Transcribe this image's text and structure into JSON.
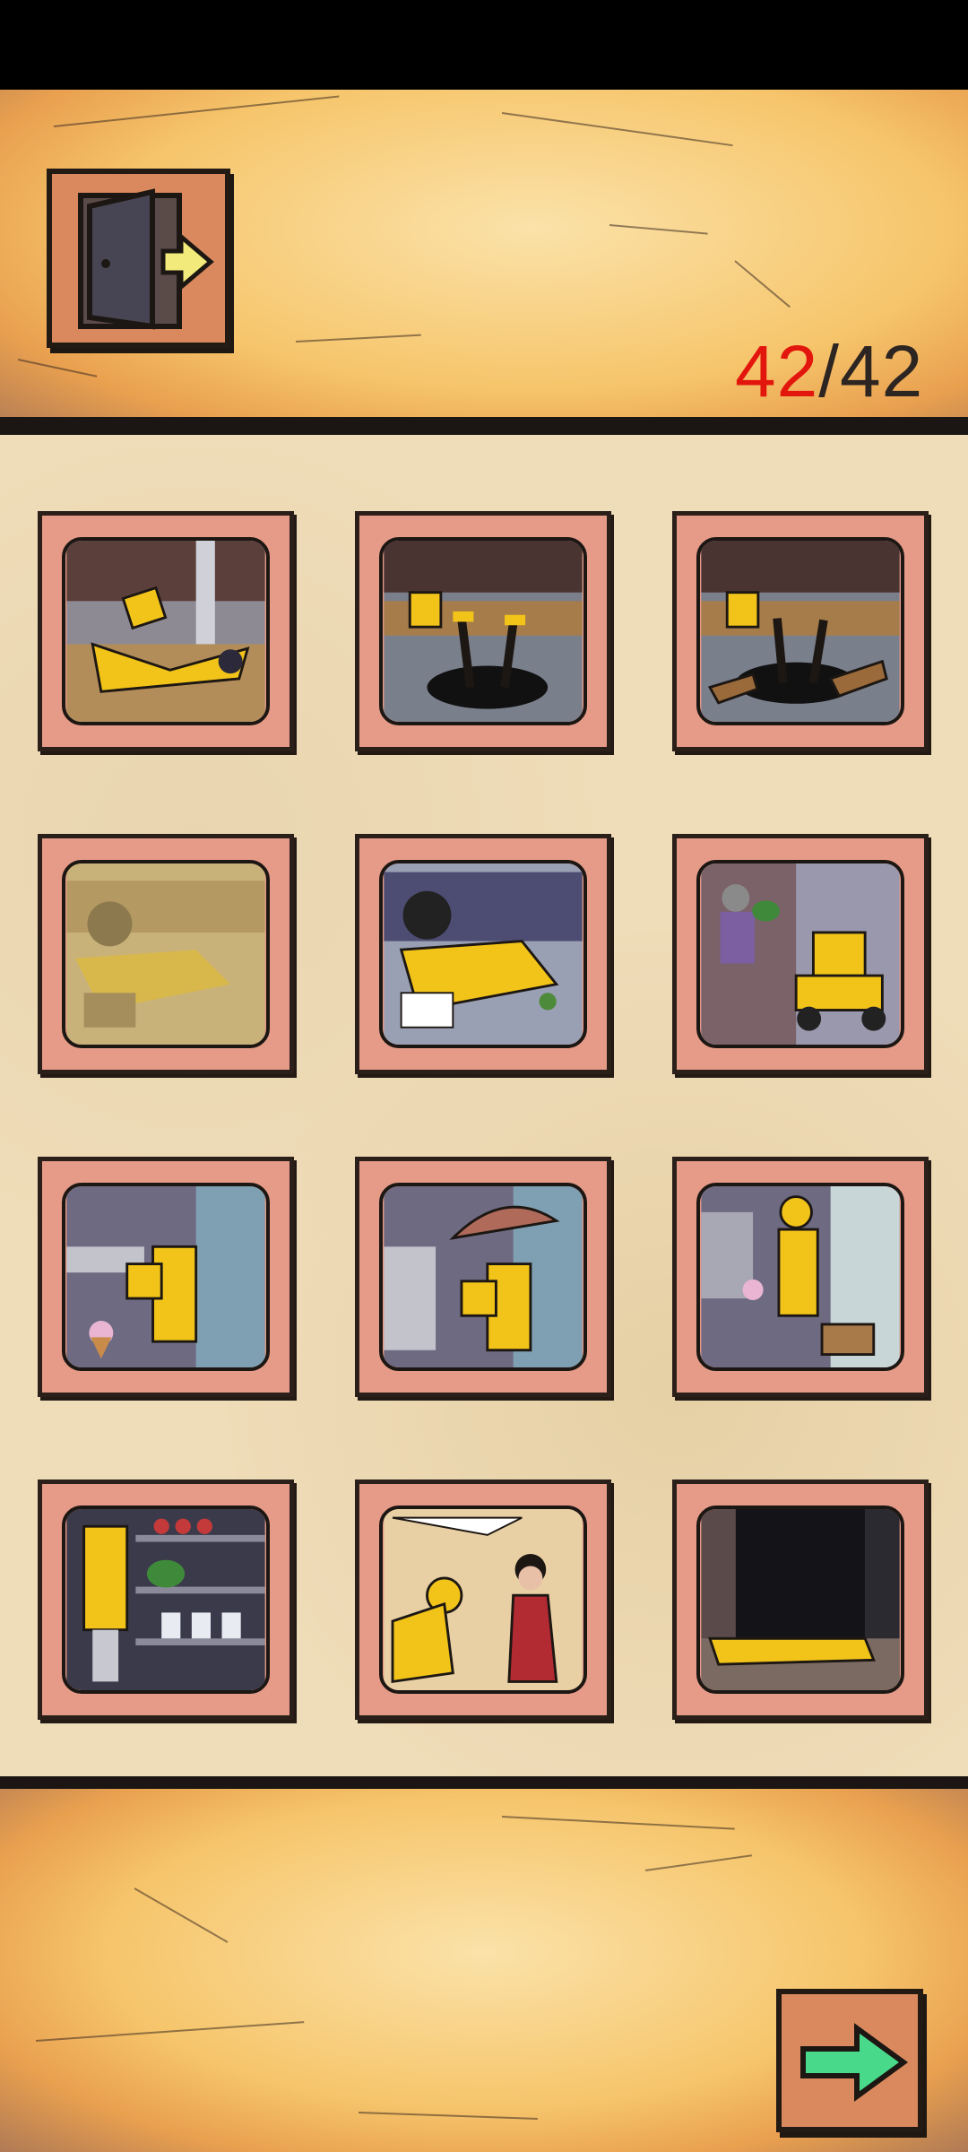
{
  "header": {
    "exit_icon": "door-exit-icon"
  },
  "counter": {
    "current": "42",
    "separator": "/",
    "total": "42"
  },
  "gallery": {
    "panels": [
      {
        "icon": "courier-fallen-panel"
      },
      {
        "icon": "courier-manhole-panel"
      },
      {
        "icon": "courier-manhole-boards-panel"
      },
      {
        "icon": "courier-car-crash-faded-panel"
      },
      {
        "icon": "courier-car-crash-panel"
      },
      {
        "icon": "courier-scooter-grandma-panel"
      },
      {
        "icon": "courier-icecream-panel"
      },
      {
        "icon": "courier-umbrella-panel"
      },
      {
        "icon": "courier-umbrella-walk-panel"
      },
      {
        "icon": "courier-store-shelf-panel"
      },
      {
        "icon": "courier-woman-red-dress-panel"
      },
      {
        "icon": "courier-doorway-panel"
      }
    ]
  },
  "footer": {
    "next_icon": "arrow-right-icon"
  },
  "colors": {
    "accent_red": "#e3160e",
    "raincoat_yellow": "#f2c419",
    "frame_pink": "#e69b88"
  }
}
